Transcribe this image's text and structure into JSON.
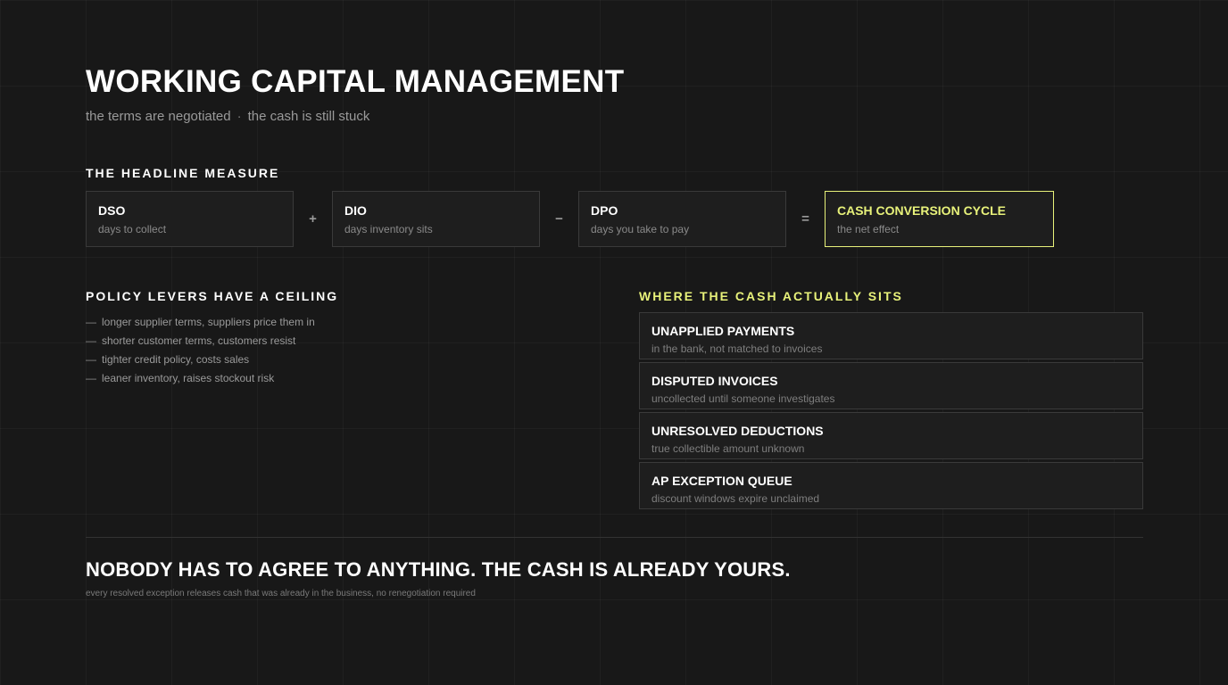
{
  "header": {
    "title": "WORKING CAPITAL MANAGEMENT",
    "subtitle_left": "the terms are negotiated",
    "subtitle_sep": "·",
    "subtitle_right": "the cash is still stuck"
  },
  "headline": {
    "label": "THE HEADLINE MEASURE",
    "terms": [
      {
        "name": "DSO",
        "desc": "days to collect"
      },
      {
        "name": "DIO",
        "desc": "days inventory sits"
      },
      {
        "name": "DPO",
        "desc": "days you take to pay"
      },
      {
        "name": "CASH CONVERSION CYCLE",
        "desc": "the net effect"
      }
    ],
    "operators": [
      "+",
      "−",
      "="
    ]
  },
  "levers": {
    "label": "POLICY LEVERS HAVE A CEILING",
    "dash": "—",
    "items": [
      "longer supplier terms, suppliers price them in",
      "shorter customer terms, customers resist",
      "tighter credit policy, costs sales",
      "leaner inventory, raises stockout risk"
    ]
  },
  "cash": {
    "label": "WHERE THE CASH ACTUALLY SITS",
    "items": [
      {
        "title": "UNAPPLIED PAYMENTS",
        "desc": "in the bank, not matched to invoices"
      },
      {
        "title": "DISPUTED INVOICES",
        "desc": "uncollected until someone investigates"
      },
      {
        "title": "UNRESOLVED DEDUCTIONS",
        "desc": "true collectible amount unknown"
      },
      {
        "title": "AP EXCEPTION QUEUE",
        "desc": "discount windows expire unclaimed"
      }
    ]
  },
  "footer": {
    "title": "NOBODY HAS TO AGREE TO ANYTHING. THE CASH IS ALREADY YOURS.",
    "note": "every resolved exception releases cash that was already in the business, no renegotiation required"
  },
  "colors": {
    "background": "#181818",
    "accent": "#e8f27a",
    "card_border": "#3a3a3a",
    "muted_text": "#9a9a9a"
  }
}
